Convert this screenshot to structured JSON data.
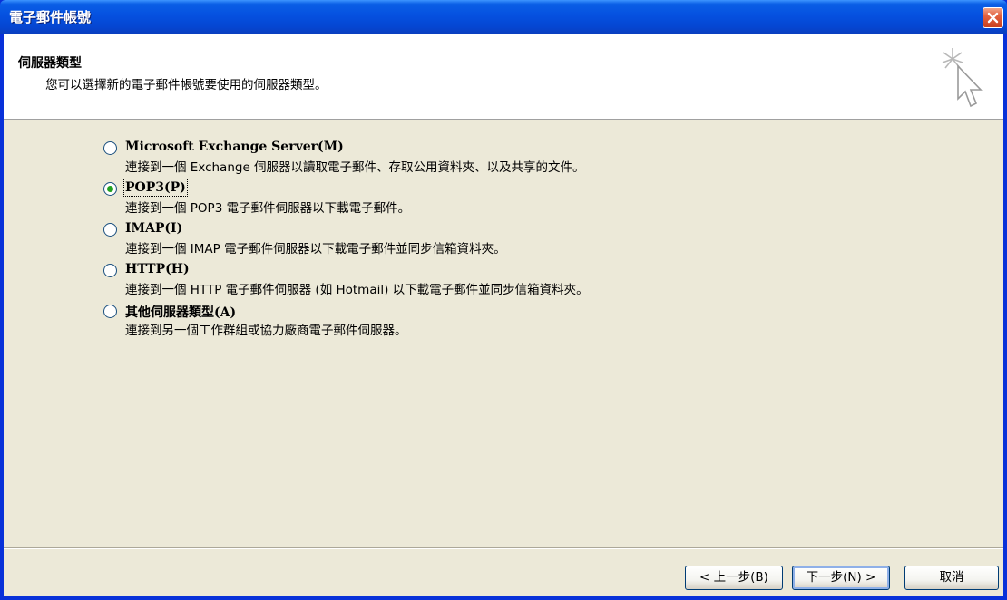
{
  "window": {
    "title": "電子郵件帳號"
  },
  "header": {
    "title": "伺服器類型",
    "subtitle": "您可以選擇新的電子郵件帳號要使用的伺服器類型。"
  },
  "options": [
    {
      "label": "Microsoft Exchange Server(M)",
      "description": "連接到一個 Exchange 伺服器以讀取電子郵件、存取公用資料夾、以及共享的文件。",
      "selected": false
    },
    {
      "label": "POP3(P)",
      "description": "連接到一個 POP3 電子郵件伺服器以下載電子郵件。",
      "selected": true
    },
    {
      "label": "IMAP(I)",
      "description": "連接到一個 IMAP 電子郵件伺服器以下載電子郵件並同步信箱資料夾。",
      "selected": false
    },
    {
      "label": "HTTP(H)",
      "description": "連接到一個 HTTP 電子郵件伺服器 (如 Hotmail) 以下載電子郵件並同步信箱資料夾。",
      "selected": false
    },
    {
      "label": "其他伺服器類型(A)",
      "description": "連接到另一個工作群組或協力廠商電子郵件伺服器。",
      "selected": false
    }
  ],
  "buttons": {
    "back": "< 上一步(B)",
    "next": "下一步(N) >",
    "cancel": "取消"
  },
  "icons": {
    "close": "close-icon",
    "header": "cursor-sparkle-icon"
  }
}
